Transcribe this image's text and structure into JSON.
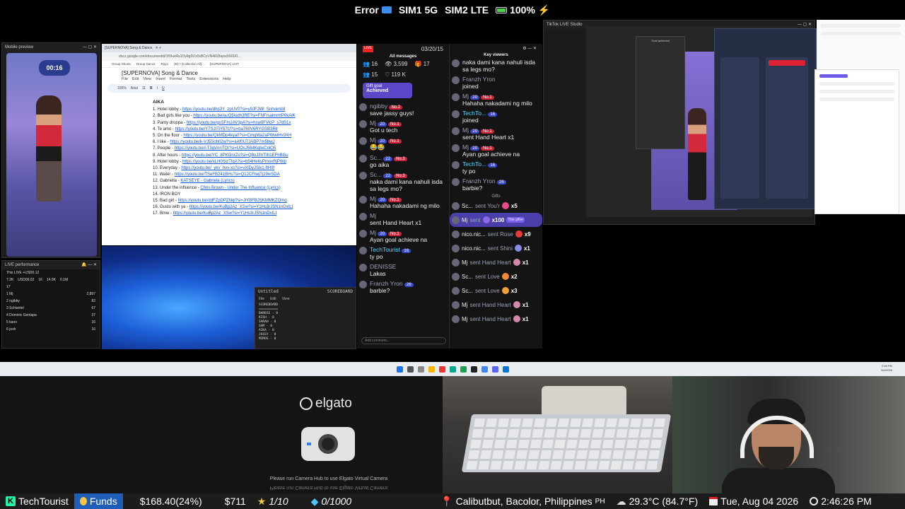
{
  "status_bar": {
    "error": "Error",
    "sim1": "SIM1 5G",
    "sim2": "SIM2 LTE",
    "battery": "100%"
  },
  "mobile_preview": {
    "title": "Mobile preview",
    "timer": "00:16"
  },
  "live_performance": {
    "title": "LIVE performance",
    "this_live": "This LIVE  +USD0.12",
    "stats": [
      "7.2K",
      "USD09.02",
      "16",
      "14.9K",
      "0.1M"
    ],
    "count": "17",
    "rows": [
      {
        "rank": "1",
        "name": "Mj",
        "value": "2,897"
      },
      {
        "rank": "2",
        "name": "ngibby",
        "value": "82"
      },
      {
        "rank": "3",
        "name": "Schiantel",
        "value": "67"
      },
      {
        "rank": "4",
        "name": "Dominic Gentapa",
        "value": "37"
      },
      {
        "rank": "5",
        "name": "kano",
        "value": "16"
      },
      {
        "rank": "6",
        "name": "josh",
        "value": "16"
      }
    ]
  },
  "gdoc": {
    "tab": "[SUPERNOVA] Song & Dance",
    "url": "docs.google.com/document/d/1fVkwRu1Oy8gDZz0sBCzVN4i0Zbqox9X6U0...",
    "bookmarks": [
      "Group Shorts",
      "Group Dance",
      "Rayo",
      "(M) • [Collection All]...",
      "[SUPERNOVA] LIST"
    ],
    "doc_title": "[SUPERNOVA] Song & Dance",
    "menu": [
      "File",
      "Edit",
      "View",
      "Insert",
      "Format",
      "Tools",
      "Extensions",
      "Help"
    ],
    "toolbar": {
      "zoom": "100%",
      "font": "Arial",
      "size": "11"
    },
    "heading": "AIKA",
    "items": [
      {
        "label": "1. Hotel lobby - ",
        "link": "https://youtu.be/dhp3Y_zpUV0?si=y9JFJWl_Snhoimbll"
      },
      {
        "label": "2. Bad girls like you - ",
        "link": "https://youtu.be/auQ5ludh3RE?si=FNFrsalmmtP0kAiK"
      },
      {
        "label": "3. Panty droppa - ",
        "link": "https://youtu.be/gsSFm2AV3pA?si=hsw0FVlcP_s7dS1x"
      },
      {
        "label": "4. Te amo - ",
        "link": "https://youtu.be/Y7SJITiY57U?si=ba760V6RYGSB3Rlr"
      },
      {
        "label": "5. On the floor - ",
        "link": "https://youtu.be/QkMDp4kya0?si=CmgWa2aPWwtHx9XH"
      },
      {
        "label": "6. I like - ",
        "link": "https://youtu.be/k-VJ5Soh02w?si=aAf0U7JABP7m5bwJ"
      },
      {
        "label": "7. People - ",
        "link": "https://youtu.be/l-T3gVnnTQI?si=UOsJ584KqtwCnlQ5"
      },
      {
        "label": "8. After hours - ",
        "link": "https://youtu.be/YC_8PKGnrZo?si=Q8oJ3VTIh1EFhBGu"
      },
      {
        "label": "9. Hotel lobby - ",
        "link": "https://youtu.be/xLH0SlzTfqA?si=b54He6sPmoxRjPWp"
      },
      {
        "label": "10. Everyday - ",
        "link": "https://youtu.be/_ykv_hvv-xs?si=vXlDyJSlx1-ftH9f"
      },
      {
        "label": "11. Water - ",
        "link": "https://youtu.be/TSeFB241BHs?si=Q12CFtwjTj29wSDA"
      },
      {
        "label": "12. Gabriella - ",
        "link": "KATSEYE - Gabriela (Lyrics)"
      },
      {
        "label": "13. Under the influence - ",
        "link": "Chris Brown - Under The Influence (Lyrics)"
      },
      {
        "label": "14. IRON BOY",
        "link": ""
      },
      {
        "label": "15. Bad girl - ",
        "link": "https://youtu.be/ddFZpDPZNql?si=JiYBFBJSKMMKZQmq"
      },
      {
        "label": "16. Gusto with ya - ",
        "link": "https://youtu.be/KuBp2Az_XSw?si=Y1Hs3rJSN1nDxILt"
      },
      {
        "label": "17. Bmw - ",
        "link": "https://youtu.be/KuBp2Az_XSw?si=Y1Hs3rJSN1nDxILt"
      }
    ]
  },
  "notepad": {
    "title": "Untitled",
    "tab": "SCOREBOARD",
    "menu": [
      "File",
      "Edit",
      "View"
    ],
    "content": "SCOREBOARD\n==========\nBARBIE - 0\nKISH - 0\nSARAH - 0\nSAM - 0\nAIKA - 0\nJASSY - 0\nMIMOS - 0"
  },
  "chat": {
    "date": "03/20/15",
    "all_messages": "All messages",
    "key_viewers": "Key viewers",
    "stats": {
      "viewers": "16",
      "views": "3,599",
      "gifts": "17",
      "comments": "15",
      "likes": "119 K"
    },
    "gift_goal": {
      "label": "Gift goal",
      "status": "Achieved"
    },
    "left": [
      {
        "user": "ngibby",
        "level": "",
        "fan": "No.2",
        "text": "save jassy guys!"
      },
      {
        "user": "Mj",
        "level": "20",
        "fan": "No.1",
        "text": "Got u tech"
      },
      {
        "user": "Mj",
        "level": "20",
        "fan": "No.1",
        "text": "😂😂"
      },
      {
        "user": "Sc...",
        "level": "22",
        "fan": "No.3",
        "text": "go aika"
      },
      {
        "user": "Sc...",
        "level": "22",
        "fan": "No.3",
        "text": "naka dami kana nahuli isda sa legs mo?"
      },
      {
        "user": "Mj",
        "level": "20",
        "fan": "No.1",
        "text": "Hahaha nakadami ng milo"
      },
      {
        "user": "Mj",
        "level": "",
        "fan": "",
        "text": "sent Hand Heart  x1"
      },
      {
        "user": "Mj",
        "level": "20",
        "fan": "No.1",
        "text": "Ayan goal achieve na"
      },
      {
        "user": "TechTourist",
        "level": "16",
        "fan": "",
        "text": "ty po"
      },
      {
        "user": "DENISSE",
        "level": "",
        "fan": "",
        "text": "Lakas"
      },
      {
        "user": "Franzh Yron",
        "level": "26",
        "fan": "",
        "text": "barbie?"
      }
    ],
    "right_top": [
      {
        "user": "",
        "level": "",
        "fan": "",
        "text": "naka dami kana nahuli isda sa legs mo?"
      },
      {
        "user": "Franzh Yron",
        "level": "",
        "fan": "",
        "text": "joined"
      },
      {
        "user": "Mj",
        "level": "20",
        "fan": "No.1",
        "text": "Hahaha nakadami ng milo"
      },
      {
        "user": "TechTo...",
        "level": "16",
        "fan": "",
        "text": "joined"
      },
      {
        "user": "Mj",
        "level": "20",
        "fan": "No.1",
        "text": "sent Hand Heart  x1"
      },
      {
        "user": "Mj",
        "level": "20",
        "fan": "No.1",
        "text": "Ayan goal achieve na"
      },
      {
        "user": "TechTo...",
        "level": "16",
        "fan": "",
        "text": "ty po"
      },
      {
        "user": "Franzh Yron",
        "level": "26",
        "fan": "",
        "text": "barbie?"
      }
    ],
    "gifts_label": "Gifts",
    "gifts": [
      {
        "user": "Sc...",
        "action": "sent You'r",
        "count": "x5"
      },
      {
        "user": "Mj",
        "action": "sent",
        "count": "x100",
        "badge": "Title gifter"
      },
      {
        "user": "nico.nic...",
        "action": "sent Rose",
        "count": "x9"
      },
      {
        "user": "nico.nic...",
        "action": "sent Shini",
        "count": "x1"
      },
      {
        "user": "Mj",
        "action": "sent Hand Heart",
        "count": "x1"
      },
      {
        "user": "Sc...",
        "action": "sent Love",
        "count": "x2"
      },
      {
        "user": "Sc...",
        "action": "sent Love",
        "count": "x3"
      },
      {
        "user": "Mj",
        "action": "sent Hand Heart",
        "count": "x1"
      },
      {
        "user": "Mj",
        "action": "sent Hand Heart",
        "count": "x1"
      }
    ],
    "input_placeholder": "Add comment..."
  },
  "studio": {
    "title": "TikTok LIVE Studio",
    "goal": "Goal achieved"
  },
  "elgato": {
    "brand": "elgato",
    "message": "Please run Camera Hub to use Elgato Virtual Camera",
    "message_mirror": "Please run Camera Hub to use Elgato Virtual Camera"
  },
  "taskbar": {
    "time": "2:46 PM",
    "date": "8/4/2026"
  },
  "ticker": {
    "channel": "TechTourist",
    "funds_label": "Funds",
    "funds_value": "$168.40(24%)",
    "balance": "$711",
    "stars": "1/10",
    "gems": "0/1000",
    "location": "Calibutbut, Bacolor, Philippines",
    "country": "PH",
    "weather": "29.3°C (84.7°F)",
    "date": "Tue, Aug 04 2026",
    "time": "2:46:26 PM"
  },
  "colors": {
    "accent": "#25f4a4",
    "funds": "#1f5eb8",
    "chat_level": "#3b48c9",
    "chat_fan": "#c9263b"
  }
}
